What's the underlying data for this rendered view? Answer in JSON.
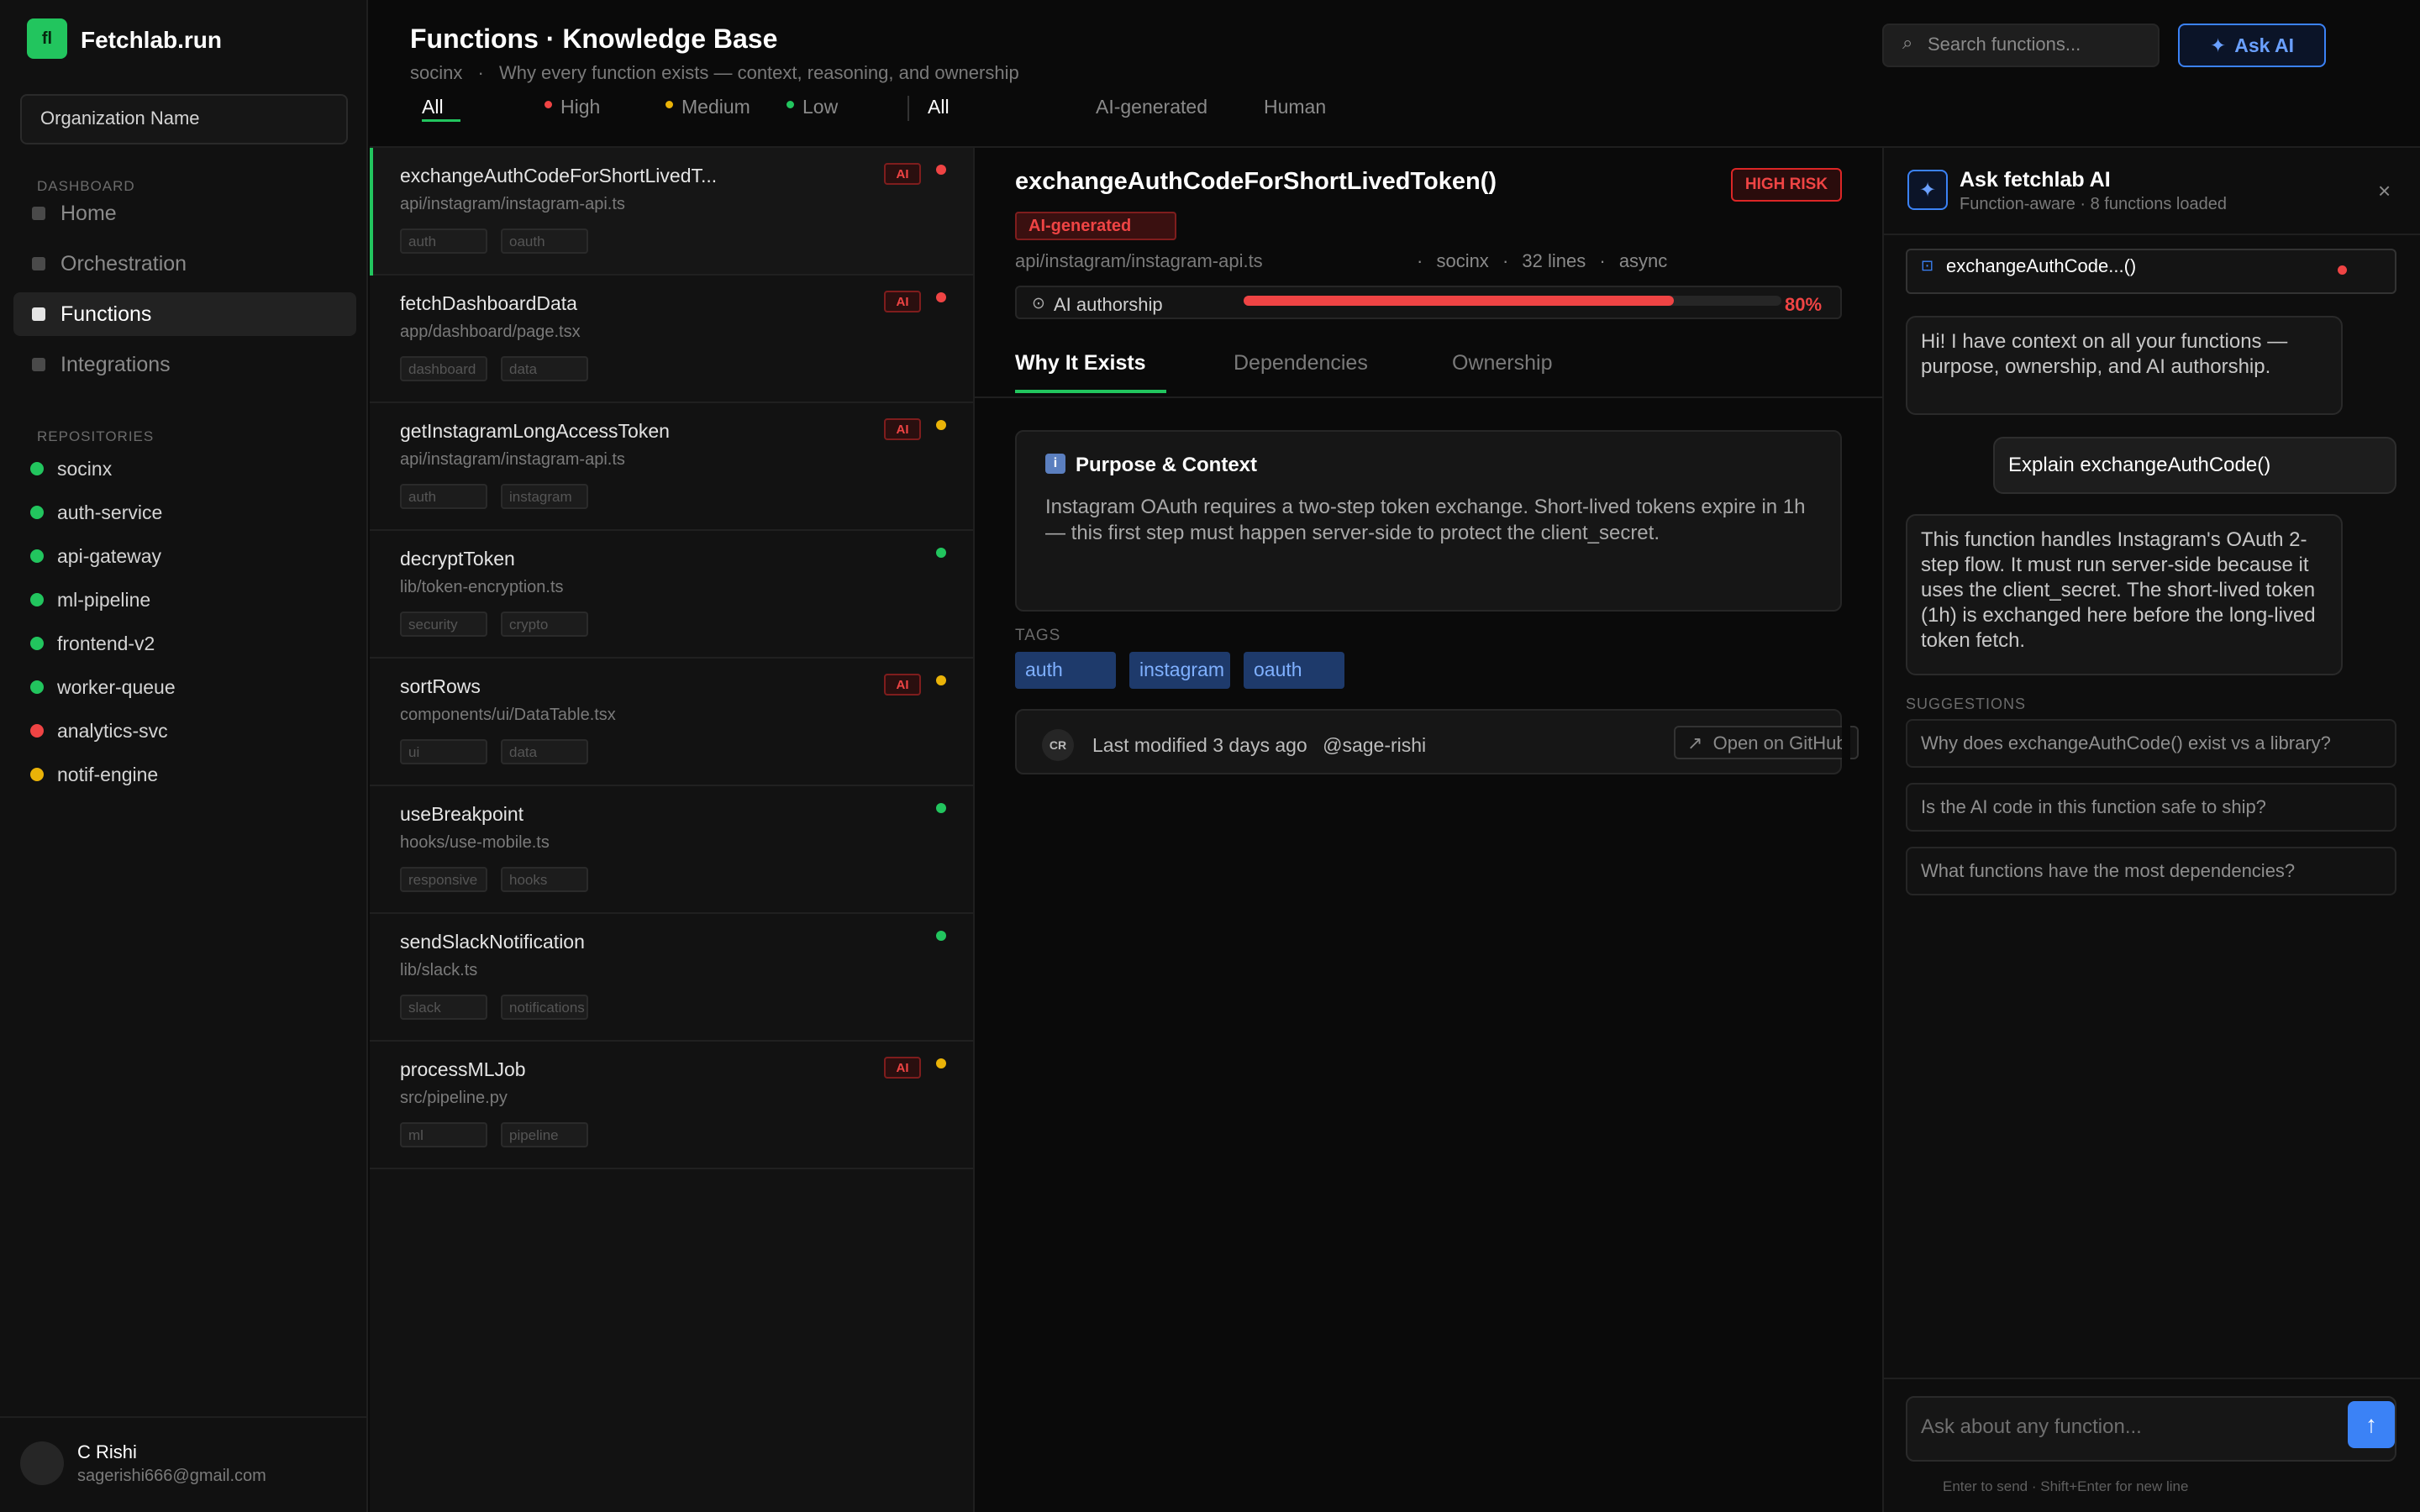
{
  "app": {
    "logo_text": "fl",
    "name": "Fetchlab.run"
  },
  "sidebar": {
    "org_name": "Organization Name",
    "dashboard_label": "DASHBOARD",
    "nav": [
      {
        "label": "Home"
      },
      {
        "label": "Orchestration"
      },
      {
        "label": "Functions",
        "active": true
      },
      {
        "label": "Integrations"
      }
    ],
    "repositories_label": "REPOSITORIES",
    "repositories": [
      {
        "name": "socinx",
        "color": "#22c55e"
      },
      {
        "name": "auth-service",
        "color": "#22c55e"
      },
      {
        "name": "api-gateway",
        "color": "#22c55e"
      },
      {
        "name": "ml-pipeline",
        "color": "#22c55e"
      },
      {
        "name": "frontend-v2",
        "color": "#22c55e"
      },
      {
        "name": "worker-queue",
        "color": "#22c55e"
      },
      {
        "name": "analytics-svc",
        "color": "#ef4444"
      },
      {
        "name": "notif-engine",
        "color": "#eab308"
      }
    ],
    "user": {
      "name": "C Rishi",
      "email": "sagerishi666@gmail.com"
    }
  },
  "header": {
    "title": "Functions · Knowledge Base",
    "repo": "socinx",
    "separator": "·",
    "tagline": "Why every function exists — context, reasoning, and ownership",
    "search_placeholder": "Search functions...",
    "ask_ai_label": "Ask AI",
    "filters": {
      "risk": [
        {
          "label": "All",
          "active": true
        },
        {
          "label": "High",
          "dot": "#ef4444"
        },
        {
          "label": "Medium",
          "dot": "#eab308"
        },
        {
          "label": "Low",
          "dot": "#22c55e"
        }
      ],
      "authorship": [
        {
          "label": "All",
          "active": true
        },
        {
          "label": "AI-generated"
        },
        {
          "label": "Human"
        }
      ]
    }
  },
  "functions": [
    {
      "name": "exchangeAuthCodeForShortLivedT...",
      "path": "api/instagram/instagram-api.ts",
      "tags": [
        "auth",
        "oauth"
      ],
      "ai_badge": "AI",
      "risk_color": "#ef4444",
      "active": true
    },
    {
      "name": "fetchDashboardData",
      "path": "app/dashboard/page.tsx",
      "tags": [
        "dashboard",
        "data"
      ],
      "ai_badge": "AI",
      "risk_color": "#ef4444"
    },
    {
      "name": "getInstagramLongAccessToken",
      "path": "api/instagram/instagram-api.ts",
      "tags": [
        "auth",
        "instagram"
      ],
      "ai_badge": "AI",
      "risk_color": "#eab308"
    },
    {
      "name": "decryptToken",
      "path": "lib/token-encryption.ts",
      "tags": [
        "security",
        "crypto"
      ],
      "ai_badge": "",
      "risk_color": "#22c55e"
    },
    {
      "name": "sortRows",
      "path": "components/ui/DataTable.tsx",
      "tags": [
        "ui",
        "data"
      ],
      "ai_badge": "AI",
      "risk_color": "#eab308"
    },
    {
      "name": "useBreakpoint",
      "path": "hooks/use-mobile.ts",
      "tags": [
        "responsive",
        "hooks"
      ],
      "ai_badge": "",
      "risk_color": "#22c55e"
    },
    {
      "name": "sendSlackNotification",
      "path": "lib/slack.ts",
      "tags": [
        "slack",
        "notifications"
      ],
      "ai_badge": "",
      "risk_color": "#22c55e"
    },
    {
      "name": "processMLJob",
      "path": "src/pipeline.py",
      "tags": [
        "ml",
        "pipeline"
      ],
      "ai_badge": "AI",
      "risk_color": "#eab308"
    }
  ],
  "detail": {
    "title": "exchangeAuthCodeForShortLivedToken()",
    "risk_badge": "HIGH RISK",
    "ai_badge": "AI-generated",
    "path": "api/instagram/instagram-api.ts",
    "meta_sep": "·",
    "repo": "socinx",
    "lines": "32 lines",
    "kind": "async",
    "authorship_label": "AI authorship",
    "authorship_percent": 80,
    "authorship_text": "80%",
    "tabs": [
      "Why It Exists",
      "Dependencies",
      "Ownership"
    ],
    "purpose_icon": "i",
    "purpose_heading": "Purpose & Context",
    "purpose_body": "Instagram OAuth requires a two-step token exchange. Short-lived tokens expire in 1h — this first step must happen server-side to protect the client_secret.",
    "tags_label": "TAGS",
    "tags": [
      "auth",
      "instagram",
      "oauth"
    ],
    "modified_initials": "CR",
    "modified_text": "Last modified 3 days ago",
    "modified_by": "@sage-rishi",
    "github_label": "Open on GitHub"
  },
  "ai_panel": {
    "title": "Ask fetchlab AI",
    "subtitle": "Function-aware · 8 functions loaded",
    "context_chip": "exchangeAuthCode...()",
    "messages": [
      {
        "role": "assistant",
        "text": "Hi! I have context on all your functions — purpose, ownership, and AI authorship."
      },
      {
        "role": "user",
        "text": "Explain exchangeAuthCode()"
      },
      {
        "role": "assistant",
        "text": "This function handles Instagram's OAuth 2-step flow. It must run server-side because it uses the client_secret. The short-lived token (1h) is exchanged here before the long-lived token fetch."
      }
    ],
    "suggestions_label": "SUGGESTIONS",
    "suggestions": [
      "Why does exchangeAuthCode() exist vs a library?",
      "Is the AI code in this function safe to ship?",
      "What functions have the most dependencies?"
    ],
    "input_placeholder": "Ask about any function...",
    "hint": "Enter to send · Shift+Enter for new line"
  },
  "icons": {
    "search": "search-icon",
    "spark": "sparkle-icon",
    "close": "close-icon",
    "send": "arrow-up-icon",
    "external": "external-link-icon",
    "clock": "clock-icon",
    "function": "function-icon"
  },
  "colors": {
    "accent_green": "#22c55e",
    "accent_blue": "#3b82f6",
    "risk_high": "#ef4444",
    "risk_medium": "#eab308"
  }
}
